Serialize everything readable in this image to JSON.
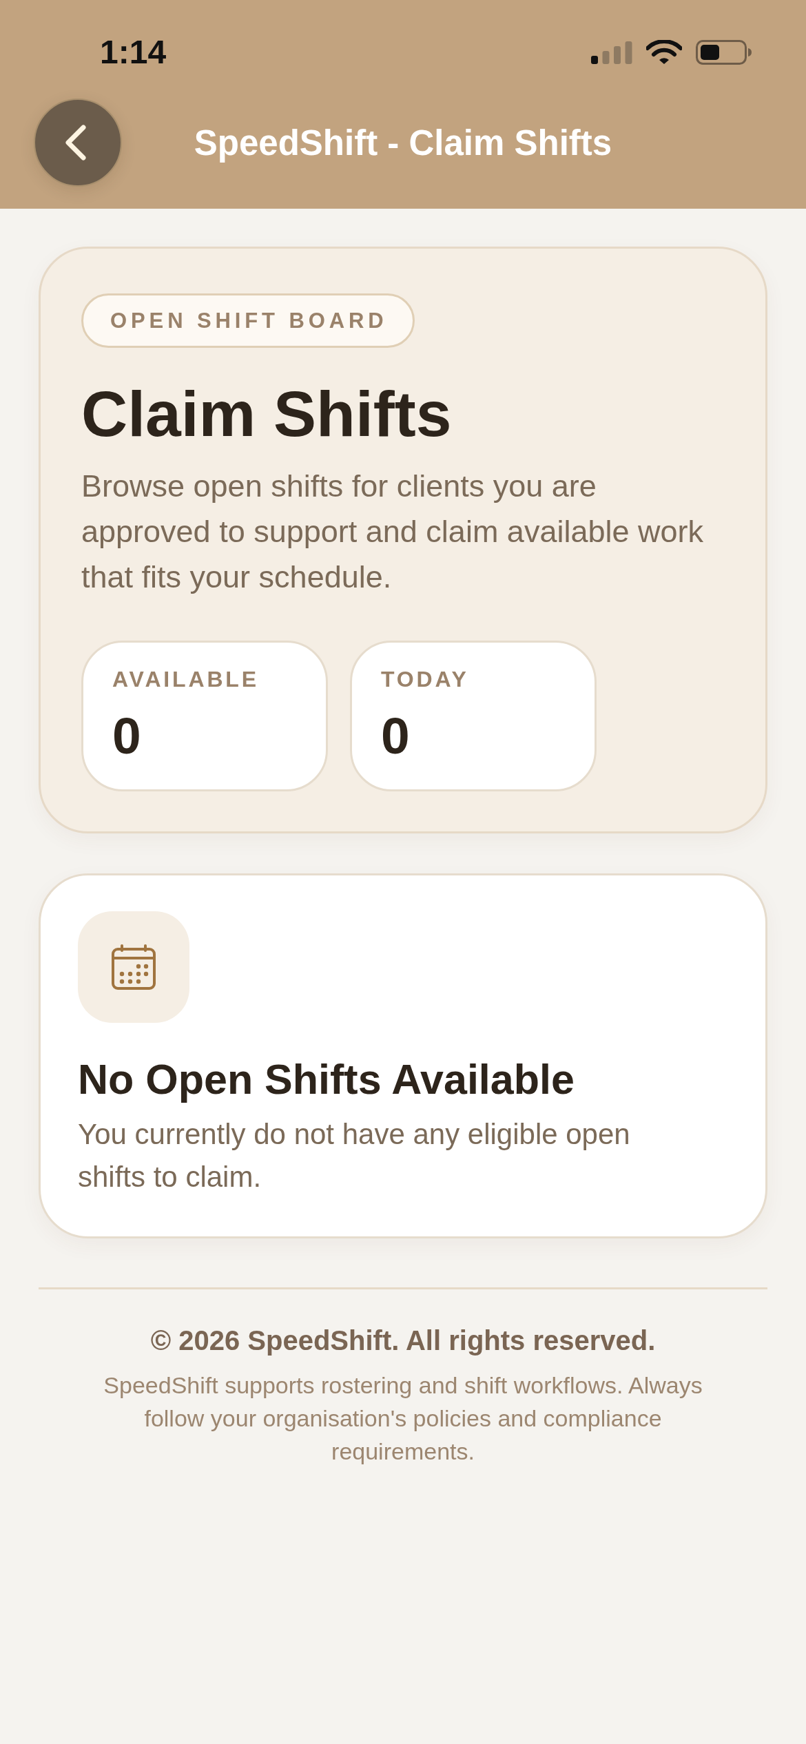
{
  "status_bar": {
    "time": "1:14"
  },
  "header": {
    "title": "SpeedShift - Claim Shifts"
  },
  "hero": {
    "badge": "OPEN SHIFT BOARD",
    "title": "Claim Shifts",
    "description": "Browse open shifts for clients you are approved to support and claim available work that fits your schedule.",
    "stats": [
      {
        "label": "AVAILABLE",
        "value": "0"
      },
      {
        "label": "TODAY",
        "value": "0"
      }
    ]
  },
  "empty_state": {
    "title": "No Open Shifts Available",
    "message": "You currently do not have any eligible open shifts to claim."
  },
  "footer": {
    "copyright": "© 2026 SpeedShift. All rights reserved.",
    "disclaimer": "SpeedShift supports rostering and shift workflows. Always follow your organisation's policies and compliance requirements."
  }
}
